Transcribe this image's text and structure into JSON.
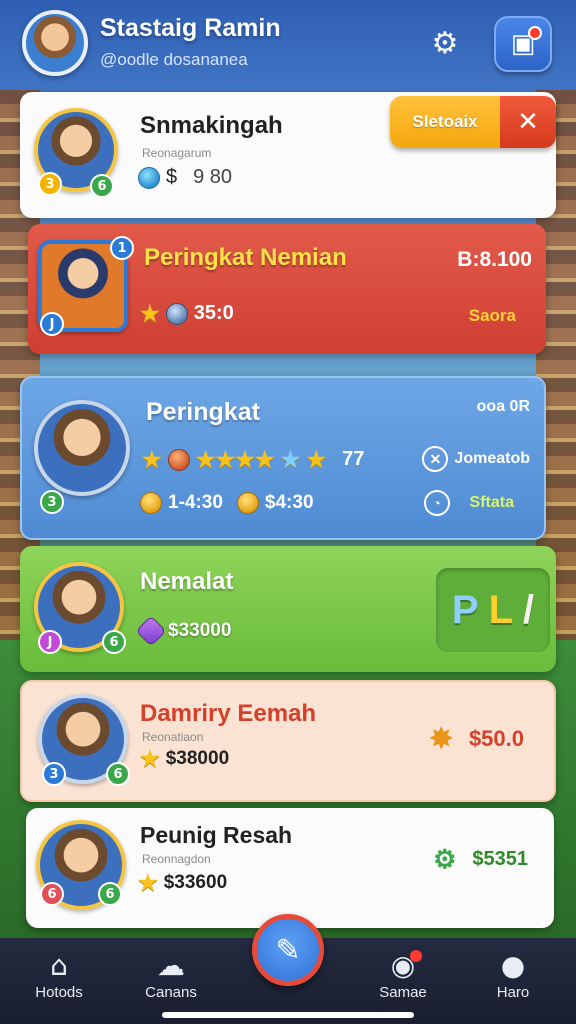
{
  "header": {
    "user_name": "Stastaig Ramin",
    "user_handle": "@oodle dosananea",
    "settings_icon": "gear-icon",
    "inbox_icon": "inbox-icon"
  },
  "cards": [
    {
      "title": "Snmakingah",
      "subtitle": "Reonagarum",
      "currency_symbol": "$",
      "value": "9 80",
      "action_label": "Sletoaix",
      "close_icon": "close-icon"
    },
    {
      "title": "Peringkat Nemian",
      "score": "35:0",
      "amount": "B:8.100",
      "status": "Saora"
    },
    {
      "title": "Peringkat",
      "rank_label": "ooa 0R",
      "stars_count": "77",
      "time_value": "1-4:30",
      "money_value": "$4:30",
      "right_label_1": "Jomeatob",
      "right_label_2": "Sftata"
    },
    {
      "title": "Nemalat",
      "value": "$33000",
      "tile_glyphs": [
        "P",
        "L",
        "/"
      ]
    },
    {
      "title": "Damriry Eemah",
      "subtitle": "Reonatiaon",
      "value": "$38000",
      "amount": "$50.0"
    },
    {
      "title": "Peunig Resah",
      "subtitle": "Reonnagdon",
      "value": "$33600",
      "amount": "$5351"
    }
  ],
  "nav": [
    {
      "label": "Hotods",
      "icon": "home-icon"
    },
    {
      "label": "Canans",
      "icon": "chat-icon"
    },
    {
      "label": "Samae",
      "icon": "game-icon"
    },
    {
      "label": "Haro",
      "icon": "profile-icon"
    }
  ],
  "center_action_icon": "edit-icon",
  "colors": {
    "accent_blue": "#2f6fd6",
    "card_red": "#d63a1e",
    "card_green": "#69bb3b",
    "pill_orange": "#f5a60d"
  }
}
